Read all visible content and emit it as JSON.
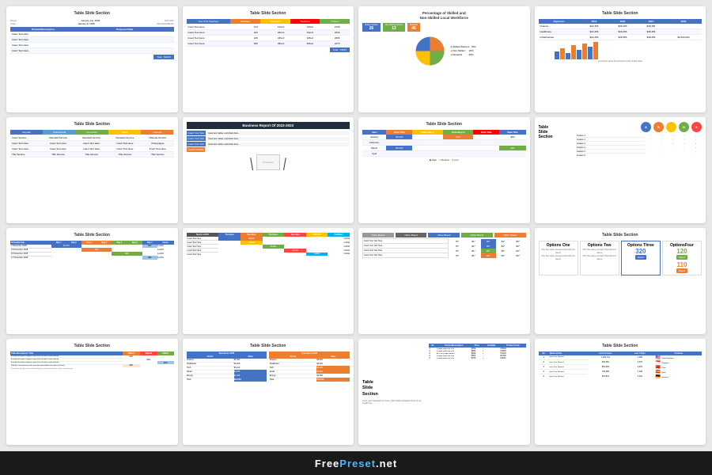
{
  "watermark": {
    "text_free": "Free",
    "text_preset": "Preset",
    "text_net": ".net"
  },
  "slides": [
    {
      "id": 1,
      "title": "Table Slide Section",
      "type": "invoice"
    },
    {
      "id": 2,
      "title": "Table Slide Section",
      "type": "color-tabs-table"
    },
    {
      "id": 3,
      "title": "Percentage of Skilled and Non-Skilled Local Workforce",
      "type": "pie-chart"
    },
    {
      "id": 4,
      "title": "Table Slide Section",
      "type": "line-bar-chart"
    },
    {
      "id": 5,
      "title": "Table Slide Section",
      "type": "multi-color-table"
    },
    {
      "id": 6,
      "title": "Business Report Of 2022-2023",
      "type": "dark-report"
    },
    {
      "id": 7,
      "title": "Table Slide Section",
      "type": "status-table"
    },
    {
      "id": 8,
      "title": "Table Slide Section",
      "type": "circles-features"
    },
    {
      "id": 9,
      "title": "Table Slide Section",
      "type": "schedule"
    },
    {
      "id": 10,
      "title": "",
      "type": "comparison-colored"
    },
    {
      "id": 11,
      "title": "",
      "type": "non-list-table"
    },
    {
      "id": 12,
      "title": "Table Slide Section",
      "type": "option-cards"
    },
    {
      "id": 13,
      "title": "Table Slide Section",
      "type": "description-table"
    },
    {
      "id": 14,
      "title": "Table Slide Section",
      "type": "two-tables"
    },
    {
      "id": 15,
      "title": "Table Slide Section",
      "type": "text-table"
    },
    {
      "id": 16,
      "title": "Table Slide Section",
      "type": "product-flags"
    }
  ]
}
